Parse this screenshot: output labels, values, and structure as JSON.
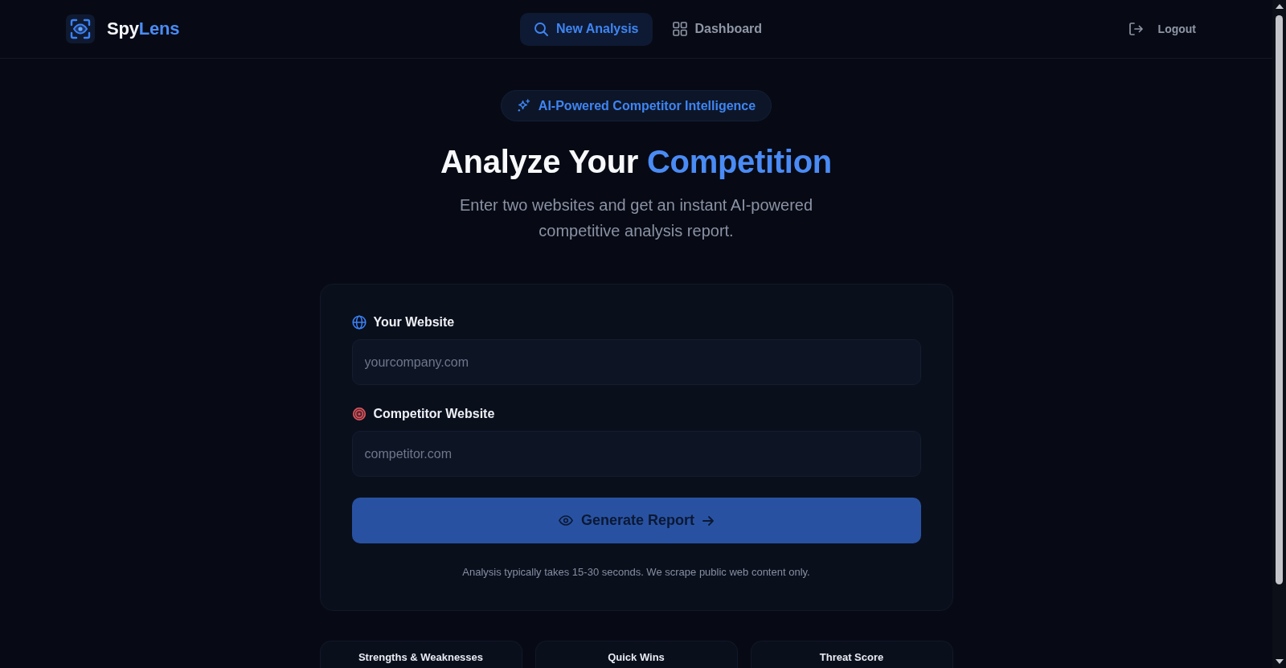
{
  "logo": {
    "text": "Spy",
    "highlight": "Lens"
  },
  "nav": {
    "tabs": [
      {
        "label": "New Analysis",
        "selected": true
      },
      {
        "label": "Dashboard",
        "selected": false
      }
    ],
    "logout": "Logout"
  },
  "hero": {
    "badge": "AI-Powered Competitor Intelligence",
    "title": {
      "text": "Analyze Your",
      "highlight": "Competition"
    },
    "subtitle": "Enter two websites and get an instant AI-powered competitive analysis report."
  },
  "form": {
    "fields": [
      {
        "label": "Your Website",
        "placeholder": "yourcompany.com"
      },
      {
        "label": "Competitor Website",
        "placeholder": "competitor.com"
      }
    ],
    "submit": "Generate Report",
    "note": "Analysis typically takes 15-30 seconds. We scrape public web content only."
  },
  "features": [
    {
      "title": "Strengths & Weaknesses"
    },
    {
      "title": "Quick Wins"
    },
    {
      "title": "Threat Score"
    }
  ]
}
